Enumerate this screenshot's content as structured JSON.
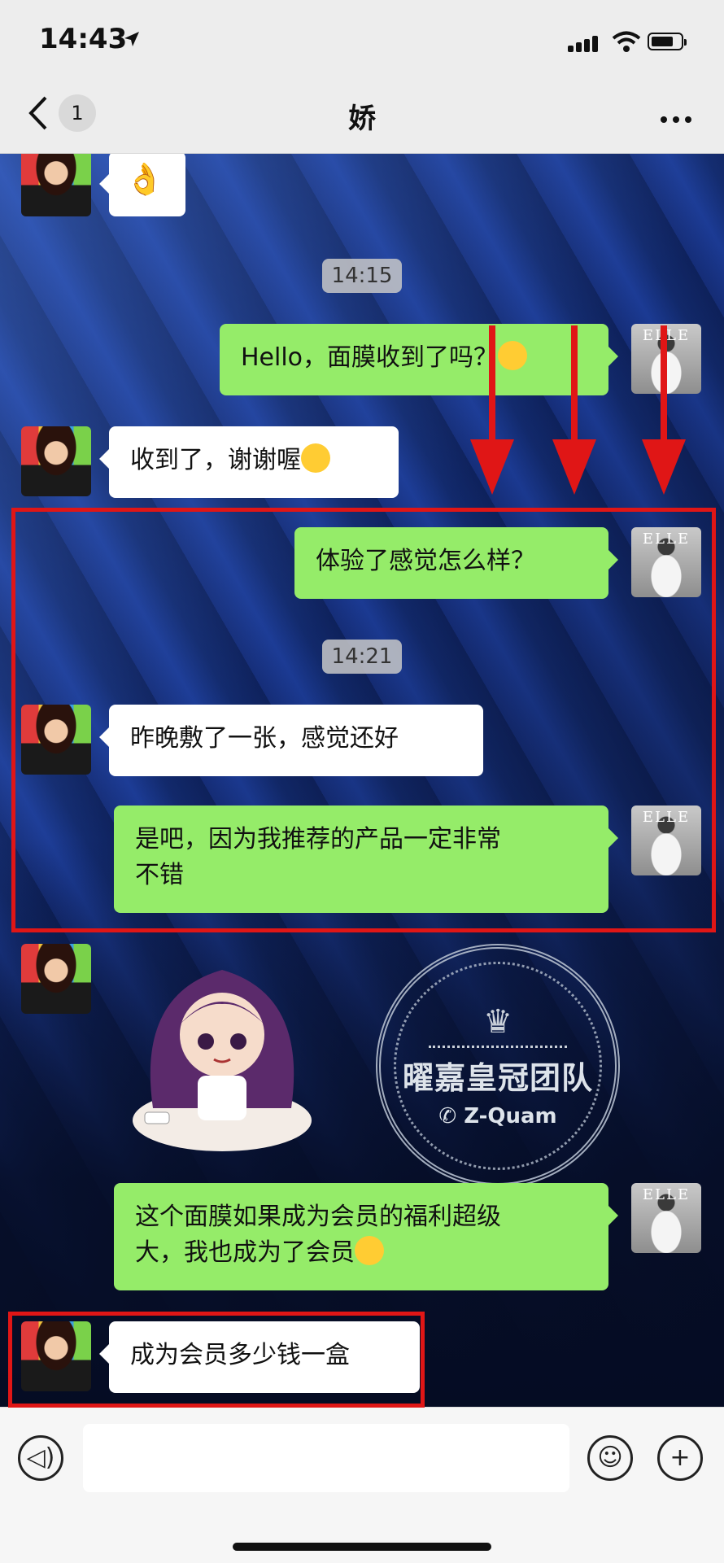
{
  "status_bar": {
    "time": "14:43"
  },
  "header": {
    "unread_count": "1",
    "title": "娇"
  },
  "messages": {
    "m0_emoji": "👌",
    "ts1": "14:15",
    "m1": "Hello，面膜收到了吗？",
    "m2": "收到了，谢谢喔",
    "m3": "体验了感觉怎么样？",
    "ts2": "14:21",
    "m4": "昨晚敷了一张，感觉还好",
    "m5": "是吧，因为我推荐的产品一定非常\n不错",
    "m6": "这个面膜如果成为会员的福利超级\n大，我也成为了会员",
    "m7": "成为会员多少钱一盒"
  },
  "watermark": {
    "title": "曜嘉皇冠团队",
    "sub": "Z-Quam",
    "avatar_mark": "ELLE"
  },
  "colors": {
    "outgoing_bubble": "#95ec69",
    "incoming_bubble": "#ffffff",
    "highlight": "#e01616"
  }
}
